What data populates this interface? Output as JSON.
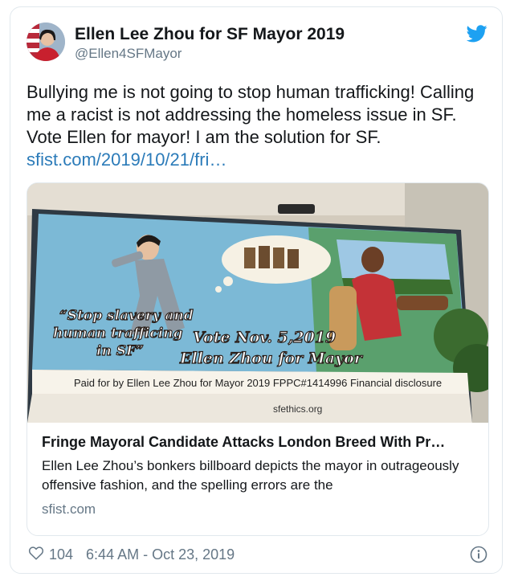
{
  "tweet": {
    "author_name": "Ellen Lee Zhou for SF Mayor 2019",
    "author_handle": "@Ellen4SFMayor",
    "text": "Bullying me is not going to stop human trafficking! Calling me a racist is not addressing the homeless issue in SF. Vote Ellen for mayor! I am the solution for SF.",
    "link_text": "sfist.com/2019/10/21/fri…"
  },
  "link_card": {
    "title": "Fringe Mayoral Candidate Attacks London Breed With Pr…",
    "description": "Ellen Lee Zhou’s bonkers billboard depicts the mayor in outrageously offensive fashion, and the spelling errors are the",
    "domain": "sfist.com",
    "billboard": {
      "quote_line1": "“Stop slavery and",
      "quote_line2": "human trafficing",
      "quote_line3": "in SF”",
      "vote_line": "Vote Nov. 5,2019",
      "mayor_line": "Ellen Zhou for Mayor",
      "paid_line": "Paid for by Ellen Lee Zhou for Mayor 2019 FPPC#1414996 Financial disclosure",
      "ethics_line": "sfethics.org"
    }
  },
  "footer": {
    "likes": "104",
    "timestamp": "6:44 AM - Oct 23, 2019"
  },
  "icons": {
    "brand": "twitter-bird-icon",
    "like": "heart-icon",
    "info": "info-icon"
  },
  "colors": {
    "twitter_blue": "#1da1f2",
    "link": "#2b7bb9",
    "muted": "#657786",
    "border": "#e1e8ed"
  }
}
